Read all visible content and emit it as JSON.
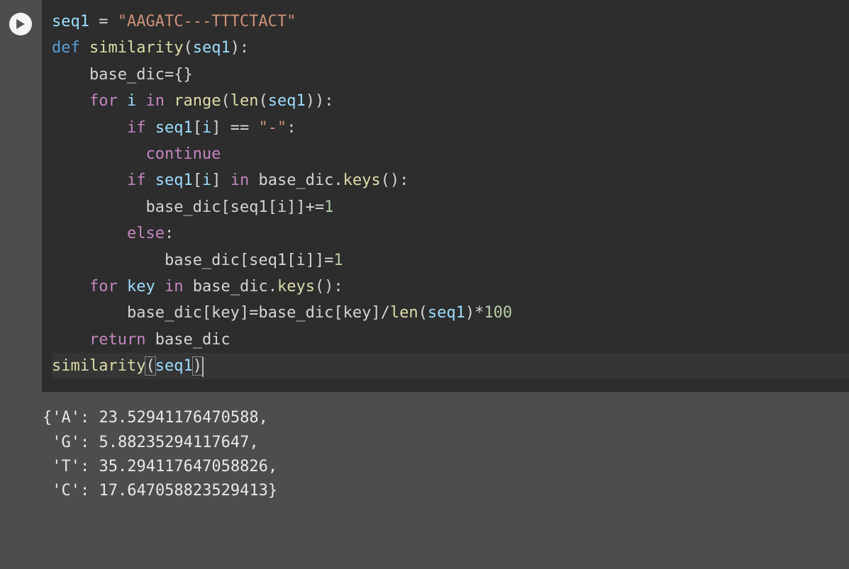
{
  "code": {
    "line1": {
      "var": "seq1",
      "eq": " = ",
      "str": "\"AAGATC---TTTCTACT\""
    },
    "line2": {
      "kw": "def",
      "sp": " ",
      "fn": "similarity",
      "op1": "(",
      "arg": "seq1",
      "op2": "):"
    },
    "line3": {
      "indent": "    ",
      "t1": "base_dic",
      "t2": "=",
      "t3": "{}"
    },
    "line4": {
      "indent": "    ",
      "kw": "for",
      "sp1": " ",
      "v": "i",
      "sp2": " ",
      "kw2": "in",
      "sp3": " ",
      "fn": "range",
      "op1": "(",
      "fn2": "len",
      "op2": "(",
      "arg": "seq1",
      "op3": ")):"
    },
    "line5": {
      "indent": "        ",
      "kw": "if",
      "sp": " ",
      "v": "seq1",
      "op1": "[",
      "idx": "i",
      "op2": "] == ",
      "str": "\"-\"",
      "op3": ":"
    },
    "line6": {
      "indent": "          ",
      "kw": "continue"
    },
    "line7": {
      "indent": "        ",
      "kw": "if",
      "sp1": " ",
      "v1": "seq1",
      "op1": "[",
      "idx1": "i",
      "op2": "] ",
      "kw2": "in",
      "sp2": " ",
      "v2": "base_dic",
      "op3": ".",
      "fn": "keys",
      "op4": "():"
    },
    "line8": {
      "indent": "          ",
      "t1": "base_dic[seq1[i]]+=",
      "num": "1"
    },
    "line9": {
      "indent": "        ",
      "kw": "else",
      "op": ":"
    },
    "line10": {
      "indent": "            ",
      "t1": "base_dic[seq1[i]]=",
      "num": "1"
    },
    "blank": "",
    "line12": {
      "indent": "    ",
      "kw": "for",
      "sp1": " ",
      "v": "key",
      "sp2": " ",
      "kw2": "in",
      "sp3": " ",
      "v2": "base_dic",
      "op1": ".",
      "fn": "keys",
      "op2": "():"
    },
    "line13": {
      "indent": "        ",
      "t1": "base_dic[key]=base_dic[key]/",
      "fn": "len",
      "op1": "(",
      "arg": "seq1",
      "op2": ")*",
      "num": "100"
    },
    "line14": {
      "indent": "    ",
      "kw": "return",
      "sp": " ",
      "t1": "base_dic"
    },
    "line15": {
      "fn": "similarity",
      "op1": "(",
      "arg": "seq1",
      "op2": ")"
    }
  },
  "output": {
    "l1": "{'A': 23.52941176470588,",
    "l2": " 'G': 5.88235294117647,",
    "l3": " 'T': 35.294117647058826,",
    "l4": " 'C': 17.647058823529413}"
  }
}
